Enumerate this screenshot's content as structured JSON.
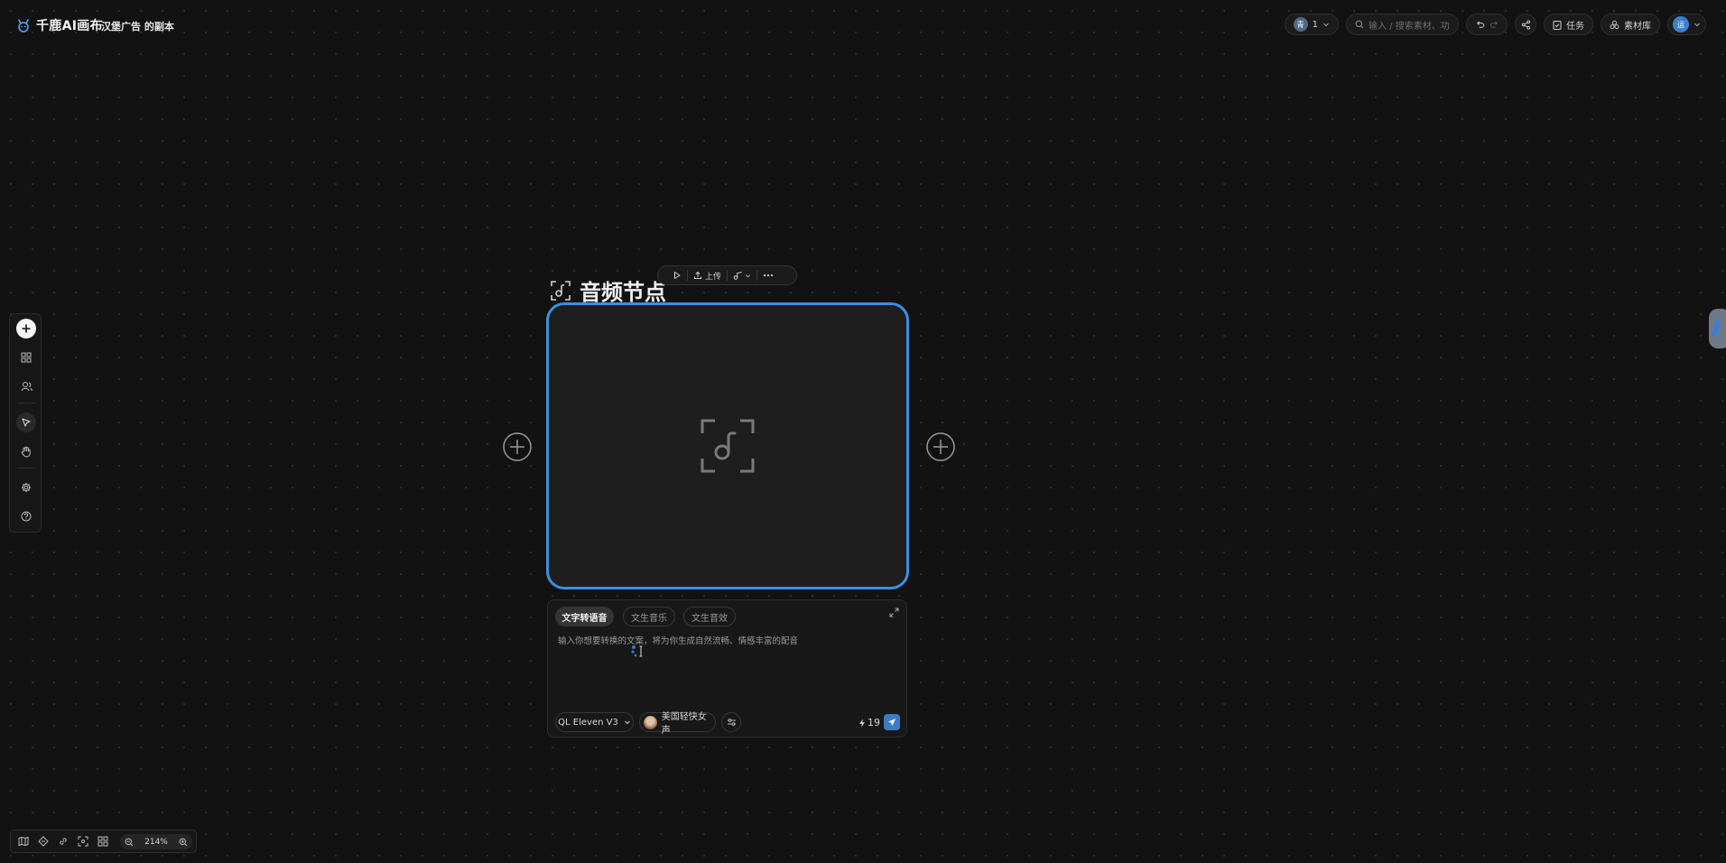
{
  "app": {
    "brand_name": "千鹿AI画布",
    "document_title": "汉堡广告 的副本",
    "brand_color": "#4da3ff"
  },
  "topbar": {
    "member_initial": "青",
    "member_count": "1",
    "search_placeholder": "输入 / 搜索素材、功能",
    "tasks_label": "任务",
    "library_label": "素材库",
    "user_avatar_text": "运"
  },
  "left_toolbar": {
    "tools": [
      "add-icon",
      "grid-icon",
      "users-icon",
      "pointer-icon",
      "hand-icon",
      "gear-icon",
      "help-icon"
    ],
    "active_tool": "pointer-icon"
  },
  "node": {
    "title": "音频节点",
    "toolbar_upload_label": "上传",
    "border_color": "#3d8ee2"
  },
  "panel": {
    "tabs": [
      {
        "label": "文字转语音",
        "active": true
      },
      {
        "label": "文生音乐",
        "active": false
      },
      {
        "label": "文生音效",
        "active": false
      }
    ],
    "prompt_placeholder": "输入你想要转换的文案，将为你生成自然流畅、情感丰富的配音",
    "model_label": "QL Eleven V3",
    "voice_label": "美国轻快女声",
    "credits": "19"
  },
  "bottom_bar": {
    "icons": [
      "map-icon",
      "connect-icon",
      "link-icon",
      "fit-icon",
      "grid-icon"
    ],
    "zoom_level": "214%"
  }
}
